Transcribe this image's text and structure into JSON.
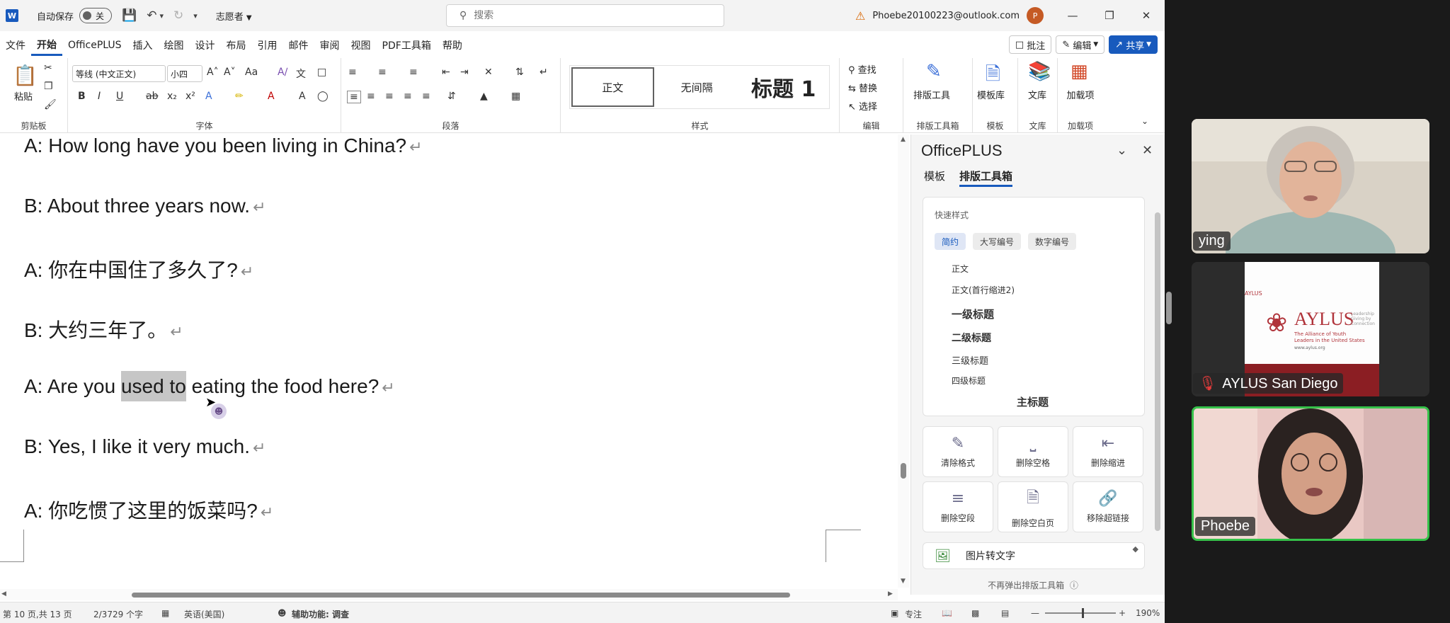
{
  "titlebar": {
    "autosave_label": "自动保存",
    "autosave_state": "关",
    "mode": "志愿者",
    "search_placeholder": "搜索",
    "account_email": "Phoebe20100223@outlook.com",
    "avatar_letter": "P"
  },
  "menu_tabs": [
    "文件",
    "开始",
    "OfficePLUS",
    "插入",
    "绘图",
    "设计",
    "布局",
    "引用",
    "邮件",
    "审阅",
    "视图",
    "PDF工具箱",
    "帮助"
  ],
  "active_tab": "开始",
  "tab_actions": {
    "comments": "批注",
    "editing": "编辑",
    "share": "共享"
  },
  "ribbon": {
    "paste_label": "粘贴",
    "font_name": "等线 (中文正文)",
    "font_size": "小四",
    "styles": [
      "正文",
      "无间隔",
      "标题 1"
    ],
    "find": "查找",
    "replace": "替换",
    "select": "选择",
    "typeset_tools": "排版工具",
    "template_lib": "模板库",
    "library": "文库",
    "addins": "加载项",
    "group_labels": {
      "clipboard": "剪贴板",
      "font": "字体",
      "paragraph": "段落",
      "styles": "样式",
      "editing": "编辑",
      "typeset": "排版工具箱",
      "template": "模板",
      "library": "文库",
      "addins": "加载项"
    }
  },
  "document": {
    "lines": [
      "A: How long have you been living in China?",
      "B: About three years now.",
      "A:  你在中国住了多久了?",
      "B:  大约三年了。",
      "A: Are you used to eating the food here?",
      "B: Yes, I like it very much.",
      "A:  你吃惯了这里的饭菜吗?"
    ],
    "highlight_before": "A: Are you ",
    "highlight_text": "used to",
    "highlight_after": " eating the food here?"
  },
  "panel": {
    "title": "OfficePLUS",
    "tabs": [
      "模板",
      "排版工具箱"
    ],
    "active_tab": "排版工具箱",
    "quick_styles_title": "快速样式",
    "chips": [
      "简约",
      "大写编号",
      "数字编号"
    ],
    "style_list": [
      "正文",
      "正文(首行缩进2)",
      "一级标题",
      "二级标题",
      "三级标题",
      "四级标题",
      "主标题"
    ],
    "tools": [
      "清除格式",
      "删除空格",
      "删除缩进",
      "删除空段",
      "删除空白页",
      "移除超链接"
    ],
    "pic_to_text": "图片转文字",
    "footer": "不再弹出排版工具箱"
  },
  "statusbar": {
    "page": "第 10 页,共 13 页",
    "words": "2/3729 个字",
    "language": "英语(美国)",
    "accessibility": "辅助功能: 调查",
    "focus": "专注",
    "zoom": "190%"
  },
  "participants": [
    {
      "name": "ying",
      "muted": false
    },
    {
      "name": "AYLUS San Diego",
      "muted": true
    },
    {
      "name": "Phoebe",
      "muted": false,
      "speaking": true
    }
  ],
  "aylus_logo": {
    "brand": "AYLUS",
    "small": "AYLUS",
    "tagline": "The Alliance of Youth Leaders in the United States",
    "url": "www.aylus.org",
    "motto": "Leadership Giving by Connection"
  }
}
